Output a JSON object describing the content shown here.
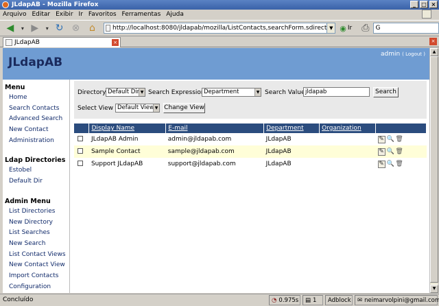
{
  "window": {
    "title": "JLdapAB - Mozilla Firefox"
  },
  "menu": [
    "Arquivo",
    "Editar",
    "Exibir",
    "Ir",
    "Favoritos",
    "Ferramentas",
    "Ajuda"
  ],
  "toolbar": {
    "url": "http://localhost:8080/jldapab/mozilla/ListContacts,searchForm.sdirect",
    "go_label": "Ir",
    "search_text": "G"
  },
  "tab": {
    "title": "JLdapAB"
  },
  "header": {
    "brand": "JLdapAB",
    "user": "admin",
    "logout": "( Logout )"
  },
  "sidebar": {
    "sections": [
      {
        "title": "Menu",
        "items": [
          "Home",
          "Search Contacts",
          "Advanced Search",
          "New Contact",
          "Administration"
        ]
      },
      {
        "title": "Ldap Directories",
        "items": [
          "Estobel",
          "Default Dir"
        ]
      },
      {
        "title": "Admin Menu",
        "items": [
          "List Directories",
          "New Directory",
          "List Searches",
          "New Search",
          "List Contact Views",
          "New Contact View",
          "Import Contacts",
          "Configuration"
        ]
      }
    ]
  },
  "search_form": {
    "directory_label": "Directory",
    "directory_value": "Default Dir",
    "expression_label": "Search Expression",
    "expression_value": "Department",
    "value_label": "Search Value",
    "value_value": "jldapab",
    "search_button": "Search",
    "view_label": "Select View",
    "view_value": "Default View",
    "change_view_button": "Change View"
  },
  "table": {
    "columns": [
      "",
      "Display Name",
      "E-mail",
      "Department",
      "Organization",
      ""
    ],
    "rows": [
      {
        "name": "JLdapAB Admin",
        "email": "admin@jldapab.com",
        "department": "JLdapAB",
        "organization": ""
      },
      {
        "name": "Sample Contact",
        "email": "sample@jldapab.com",
        "department": "JLdapAB",
        "organization": ""
      },
      {
        "name": "Support JLdapAB",
        "email": "support@jldapab.com",
        "department": "JLdapAB",
        "organization": ""
      }
    ]
  },
  "status": {
    "text": "Concluído",
    "time": "0.975s",
    "count": "1",
    "adblock": "Adblock",
    "email": "neimarvolpini@gmail.com"
  },
  "colors": {
    "header_bg": "#6f9cd2",
    "table_header_bg": "#2b4c7e",
    "alt_row_bg": "#fffed8"
  }
}
